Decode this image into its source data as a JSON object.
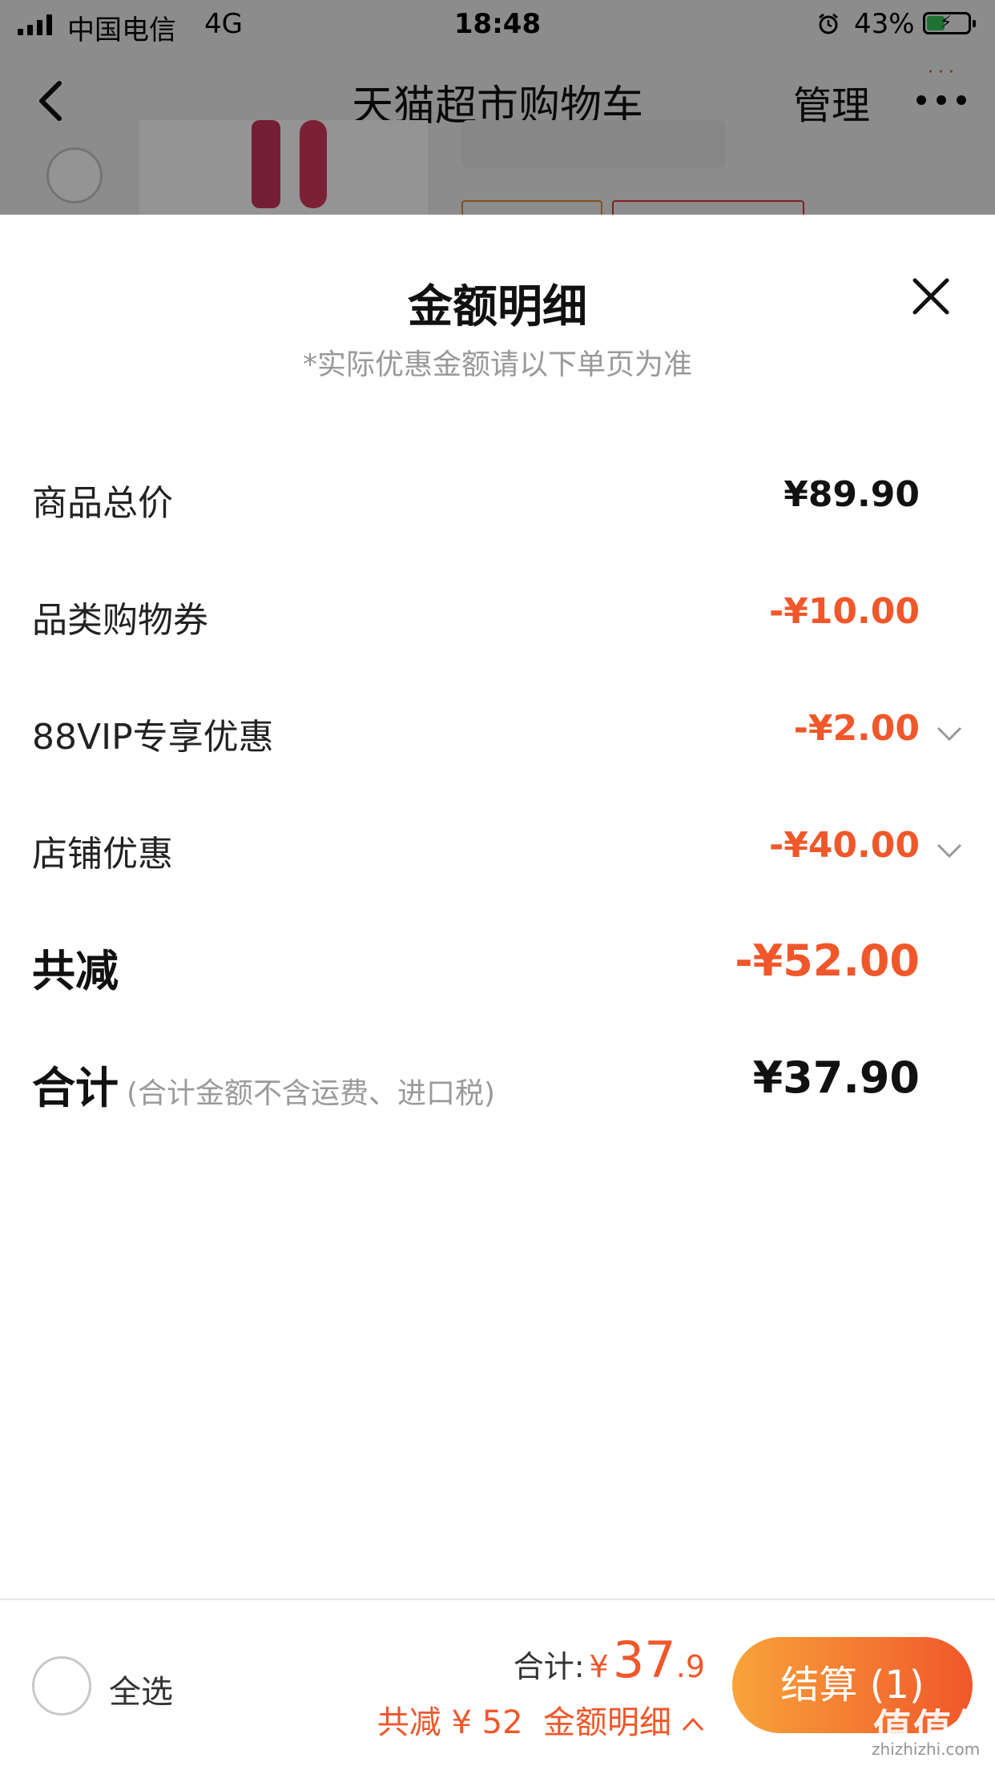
{
  "status_bar": {
    "carrier": "中国电信",
    "network": "4G",
    "time": "18:48",
    "battery": "43%",
    "battery_level": 0.43
  },
  "nav": {
    "title": "天猫超市购物车",
    "manage_label": "管理",
    "back_icon": "chevron-left-icon",
    "more_icon": "more-dots-icon"
  },
  "sheet": {
    "title": "金额明细",
    "subtitle": "*实际优惠金额请以下单页为准",
    "rows": [
      {
        "label": "商品总价",
        "value": "¥89.90"
      },
      {
        "label": "品类购物券",
        "value": "-¥10.00"
      },
      {
        "label": "88VIP专享优惠",
        "value": "-¥2.00"
      },
      {
        "label": "店铺优惠",
        "value": "-¥40.00"
      }
    ],
    "total_discount": {
      "label": "共减",
      "value": "-¥52.00"
    },
    "total": {
      "label": "合计",
      "note": "(合计金额不含运费、进口税)",
      "value": "¥37.90"
    }
  },
  "bottom_bar": {
    "select_all": "全选",
    "total_label": "合计:",
    "currency": "¥",
    "amount_int": "37",
    "amount_dec": ".9",
    "discount_text": "共减 ¥ 52",
    "detail_link": "金额明细",
    "checkout_label": "结算 (1)"
  },
  "watermark": {
    "text": "值值值",
    "sub": "zhizhizhi.com"
  },
  "colors": {
    "accent": "#f0572a",
    "gradient_start": "#f7a33a"
  }
}
